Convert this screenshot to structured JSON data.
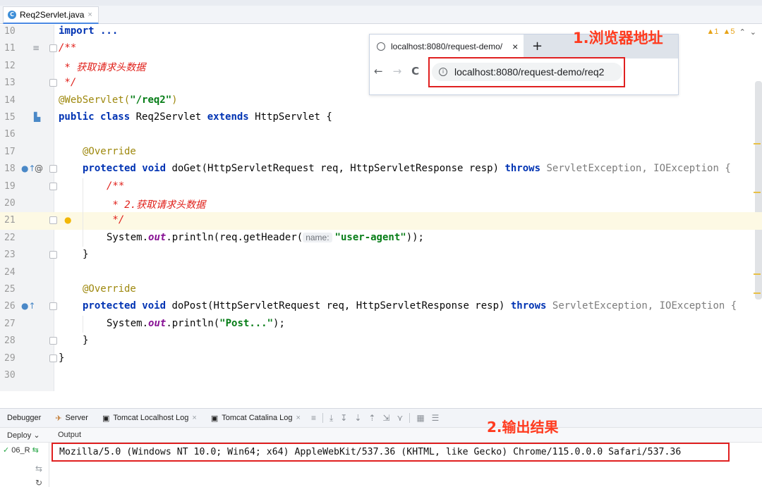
{
  "tab": {
    "icon": "java-class-icon",
    "filename": "Req2Servlet.java",
    "close": "×"
  },
  "editor": {
    "inspection": {
      "warn_a": "▲1",
      "warn_b": "▲5",
      "up": "⌃",
      "down": "⌄"
    },
    "lines": [
      {
        "n": "10",
        "code": "import ..."
      },
      {
        "n": "11",
        "code": "/**"
      },
      {
        "n": "12",
        "code": " * 获取请求头数据"
      },
      {
        "n": "13",
        "code": " */"
      },
      {
        "n": "14",
        "code_a": "@WebServlet(",
        "code_b": "\"/req2\"",
        "code_c": ")"
      },
      {
        "n": "15",
        "kw1": "public class ",
        "name": "Req2Servlet ",
        "kw2": "extends ",
        "rest": "HttpServlet {"
      },
      {
        "n": "16",
        "code": ""
      },
      {
        "n": "17",
        "code": "@Override"
      },
      {
        "n": "18",
        "kw1": "protected void ",
        "sig": "doGet(HttpServletRequest req, HttpServletResponse resp) ",
        "kw2": "throws ",
        "exc": "ServletException, IOException {"
      },
      {
        "n": "19",
        "code": "/**"
      },
      {
        "n": "20",
        "code": " * 2.获取请求头数据"
      },
      {
        "n": "21",
        "code": " */"
      },
      {
        "n": "22",
        "a": "System.",
        "b": "out",
        "c": ".println(req.getHeader(",
        "hint": "name:",
        "s": "\"user-agent\"",
        "e": "));"
      },
      {
        "n": "23",
        "code": "}"
      },
      {
        "n": "24",
        "code": ""
      },
      {
        "n": "25",
        "code": "@Override"
      },
      {
        "n": "26",
        "kw1": "protected void ",
        "sig": "doPost(HttpServletRequest req, HttpServletResponse resp) ",
        "kw2": "throws ",
        "exc": "ServletException, IOException {"
      },
      {
        "n": "27",
        "a": "System.",
        "b": "out",
        "c": ".println(",
        "s": "\"Post...\"",
        "e": ");"
      },
      {
        "n": "28",
        "code": "}"
      },
      {
        "n": "29",
        "code": "}"
      },
      {
        "n": "30",
        "code": ""
      }
    ]
  },
  "browser": {
    "tab_title": "localhost:8080/request-demo/",
    "tab_close": "×",
    "new_tab": "+",
    "back": "←",
    "forward": "→",
    "reload": "C",
    "url": "localhost:8080/request-demo/req2"
  },
  "annotations": {
    "first": "1.浏览器地址",
    "second": "2.输出结果"
  },
  "toolwindow": {
    "tabs": [
      "Debugger",
      "Server",
      "Tomcat Localhost Log",
      "Tomcat Catalina Log"
    ],
    "deploy_label": "Deploy",
    "output_label": "Output",
    "deploy_item": "06_R",
    "output": "Mozilla/5.0 (Windows NT 10.0; Win64; x64) AppleWebKit/537.36 (KHTML, like Gecko) Chrome/115.0.0.0 Safari/537.36"
  }
}
